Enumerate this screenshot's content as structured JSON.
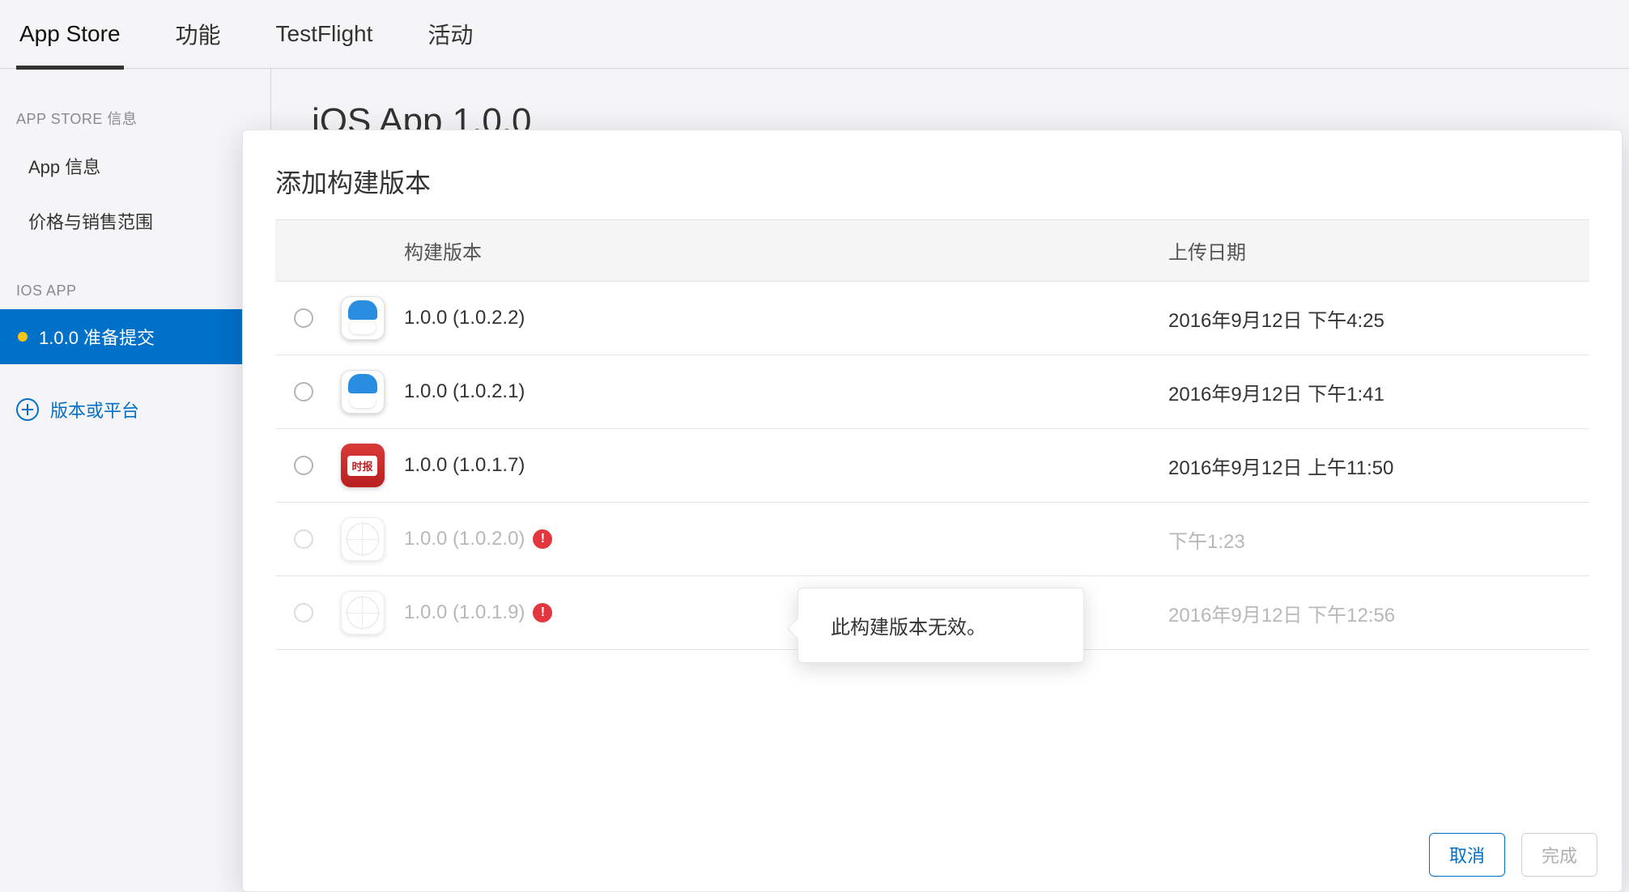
{
  "tabs": {
    "app_store": "App Store",
    "features": "功能",
    "testflight": "TestFlight",
    "activity": "活动"
  },
  "sidebar": {
    "section_app_store_info": "APP STORE 信息",
    "item_app_info": "App 信息",
    "item_pricing": "价格与销售范围",
    "section_ios_app": "iOS APP",
    "item_version_status": "1.0.0 准备提交",
    "add_version": "版本或平台"
  },
  "main": {
    "title": "iOS App 1.0.0"
  },
  "modal": {
    "title": "添加构建版本",
    "columns": {
      "build": "构建版本",
      "upload_date": "上传日期"
    },
    "builds": [
      {
        "version": "1.0.0 (1.0.2.2)",
        "date": "2016年9月12日 下午4:25",
        "invalid": false
      },
      {
        "version": "1.0.0 (1.0.2.1)",
        "date": "2016年9月12日 下午1:41",
        "invalid": false
      },
      {
        "version": "1.0.0 (1.0.1.7)",
        "date": "2016年9月12日 上午11:50",
        "invalid": false
      },
      {
        "version": "1.0.0 (1.0.2.0)",
        "date": "下午1:23",
        "invalid": true
      },
      {
        "version": "1.0.0 (1.0.1.9)",
        "date": "2016年9月12日 下午12:56",
        "invalid": true
      }
    ],
    "icon_red_label": "时报",
    "tooltip_text": "此构建版本无效。",
    "error_glyph": "!",
    "buttons": {
      "cancel": "取消",
      "done": "完成"
    }
  }
}
